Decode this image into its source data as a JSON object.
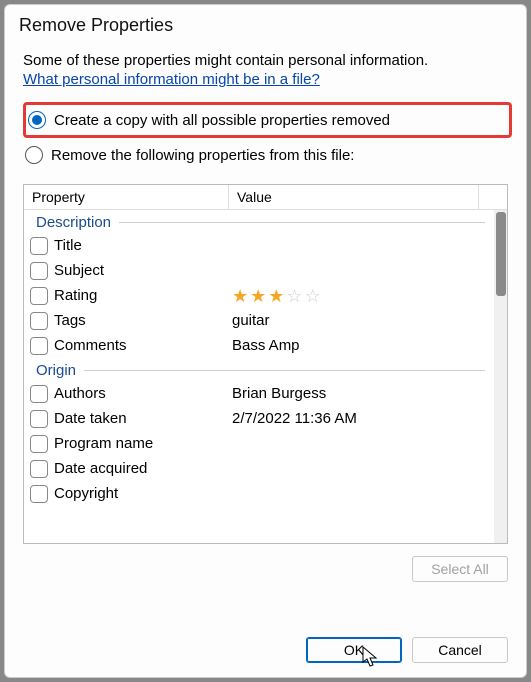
{
  "title": "Remove Properties",
  "intro": "Some of these properties might contain personal information.",
  "link": "What personal information might be in a file?",
  "radio": {
    "create_copy": "Create a copy with all possible properties removed",
    "remove_following": "Remove the following properties from this file:"
  },
  "columns": {
    "property": "Property",
    "value": "Value"
  },
  "groups": [
    {
      "label": "Description",
      "rows": [
        {
          "name": "Title",
          "value": ""
        },
        {
          "name": "Subject",
          "value": ""
        },
        {
          "name": "Rating",
          "value": "",
          "rating": 3
        },
        {
          "name": "Tags",
          "value": "guitar"
        },
        {
          "name": "Comments",
          "value": "Bass Amp"
        }
      ]
    },
    {
      "label": "Origin",
      "rows": [
        {
          "name": "Authors",
          "value": "Brian Burgess"
        },
        {
          "name": "Date taken",
          "value": "2/7/2022 11:36 AM"
        },
        {
          "name": "Program name",
          "value": ""
        },
        {
          "name": "Date acquired",
          "value": ""
        },
        {
          "name": "Copyright",
          "value": ""
        }
      ]
    }
  ],
  "buttons": {
    "select_all": "Select All",
    "ok": "OK",
    "cancel": "Cancel"
  }
}
